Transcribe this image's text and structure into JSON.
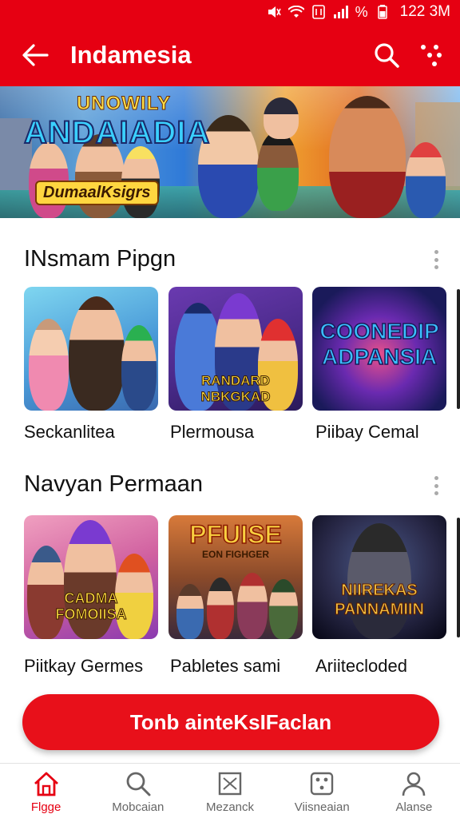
{
  "status_bar": {
    "time": "122 3M",
    "percent": "%"
  },
  "app_bar": {
    "title": "Indamesia"
  },
  "banner": {
    "logo_top": "UNOWILY",
    "logo_main": "ANDAIADIA",
    "subtitle": "DumaalKsigrs"
  },
  "sections": [
    {
      "title": "INsmam Pipgn",
      "tiles": [
        {
          "label": "Seckanlitea",
          "art_text": ""
        },
        {
          "label": "Plermousa",
          "art_text": "RANDARD NBKGKAD"
        },
        {
          "label": "Piibay Cemal",
          "art_text": "COONEDIP ADPANSIA"
        }
      ]
    },
    {
      "title": "Navyan Permaan",
      "tiles": [
        {
          "label": "Piitkay Germes",
          "art_text": "CADMA FOMOIISA"
        },
        {
          "label": "Pabletes sami",
          "art_text": "PFUISE"
        },
        {
          "label": "Ariitecloded",
          "art_text": "NIIREKAS PANNAMIIN"
        }
      ]
    }
  ],
  "tile2_small": "EON FIGHGER",
  "cta": {
    "label": "Tonb ainteKsIFaclan"
  },
  "bottom_nav": [
    {
      "label": "Flgge",
      "icon": "home-icon",
      "active": true
    },
    {
      "label": "Mobcaian",
      "icon": "search-icon",
      "active": false
    },
    {
      "label": "Mezanck",
      "icon": "image-icon",
      "active": false
    },
    {
      "label": "Viisneaian",
      "icon": "dice-icon",
      "active": false
    },
    {
      "label": "Alanse",
      "icon": "profile-icon",
      "active": false
    }
  ],
  "colors": {
    "brand_red": "#e60012"
  }
}
